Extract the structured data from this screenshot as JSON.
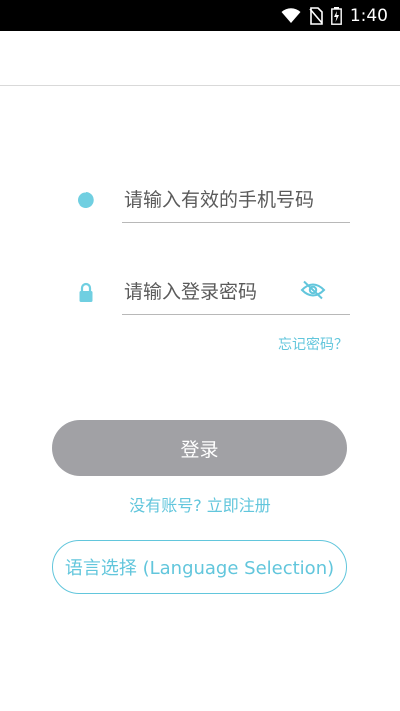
{
  "status_bar": {
    "time": "1:40"
  },
  "form": {
    "phone_placeholder": "请输入有效的手机号码",
    "password_placeholder": "请输入登录密码",
    "forgot_password": "忘记密码？",
    "login_label": "登录",
    "register_link": "没有账号? 立即注册",
    "language_button": "语言选择 (Language Selection)"
  },
  "colors": {
    "accent": "#62c6dc",
    "button_disabled": "#a1a1a5"
  }
}
